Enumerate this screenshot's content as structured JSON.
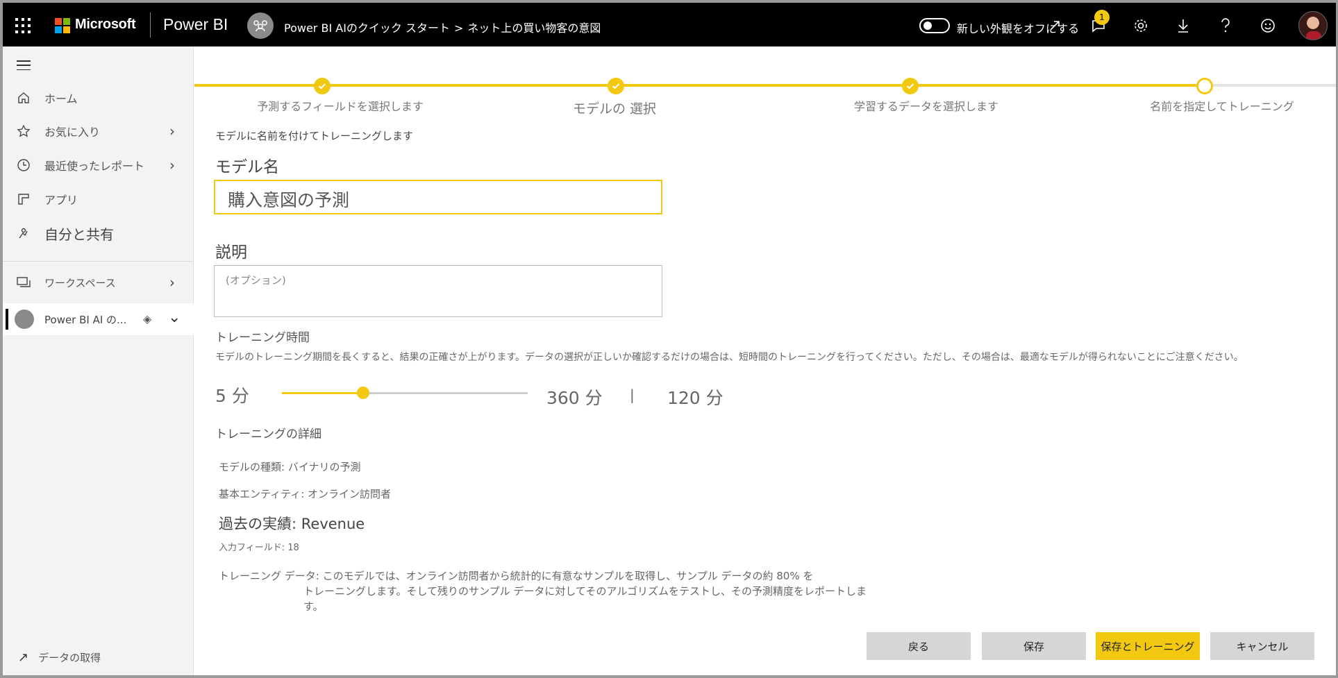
{
  "header": {
    "brand": "Microsoft",
    "app": "Power BI",
    "breadcrumb": [
      "Power BI AIのクイック スタート",
      ">",
      "ネット上の買い物客の意図"
    ],
    "toggle_label": "新しい外観をオフにする",
    "notification_count": "1"
  },
  "sidebar": {
    "items": [
      {
        "label": "ホーム",
        "icon": "home-icon"
      },
      {
        "label": "お気に入り",
        "icon": "star-icon"
      },
      {
        "label": "最近使ったレポート",
        "icon": "clock-icon"
      },
      {
        "label": "アプリ",
        "icon": "apps-icon"
      },
      {
        "label": "自分と共有",
        "icon": "share-icon"
      },
      {
        "label": "ワークスペース",
        "icon": "workspaces-icon"
      }
    ],
    "workspace": {
      "label": "Power BI AI の..."
    },
    "get_data": "データの取得"
  },
  "stepper": {
    "steps": [
      "予測するフィールドを選択します",
      "モデルの 選択",
      "学習するデータを選択します",
      "名前を指定してトレーニング"
    ]
  },
  "form": {
    "subtitle": "モデルに名前を付けてトレーニングします",
    "model_name_label": "モデル名",
    "model_name_value": "購入意図の予測",
    "description_label": "説明",
    "description_placeholder": "(オプション)",
    "training_time_label": "トレーニング時間",
    "training_time_help": "モデルのトレーニング期間を長くすると、結果の正確さが上がります。データの選択が正しいか確認するだけの場合は、短時間のトレーニングを行ってください。ただし、その場合は、最適なモデルが得られないことにご注意ください。",
    "slider": {
      "min_label": "5 分",
      "max_label": "360 分",
      "separator": "|",
      "value_label": "120 分",
      "fraction": 0.33
    },
    "details_label": "トレーニングの詳細",
    "model_type": "モデルの種類: バイナリの予測",
    "base_entity": "基本エンティティ: オンライン訪問者",
    "historical": "過去の実績: Revenue",
    "input_fields": "入力フィールド: 18",
    "training_data_1": "トレーニング データ: このモデルでは、オンライン訪問者から統計的に有意なサンプルを取得し、サンプル データの約 80% を",
    "training_data_2": "トレーニングします。そして残りのサンプル データに対してそのアルゴリズムをテストし、その予測精度をレポートします。"
  },
  "buttons": {
    "back": "戻る",
    "save": "保存",
    "save_train": "保存とトレーニング",
    "cancel": "キャンセル"
  },
  "colors": {
    "accent": "#f2c811",
    "topbar": "#000000",
    "sidebar": "#f3f3f3",
    "button": "#d6d6d6"
  }
}
